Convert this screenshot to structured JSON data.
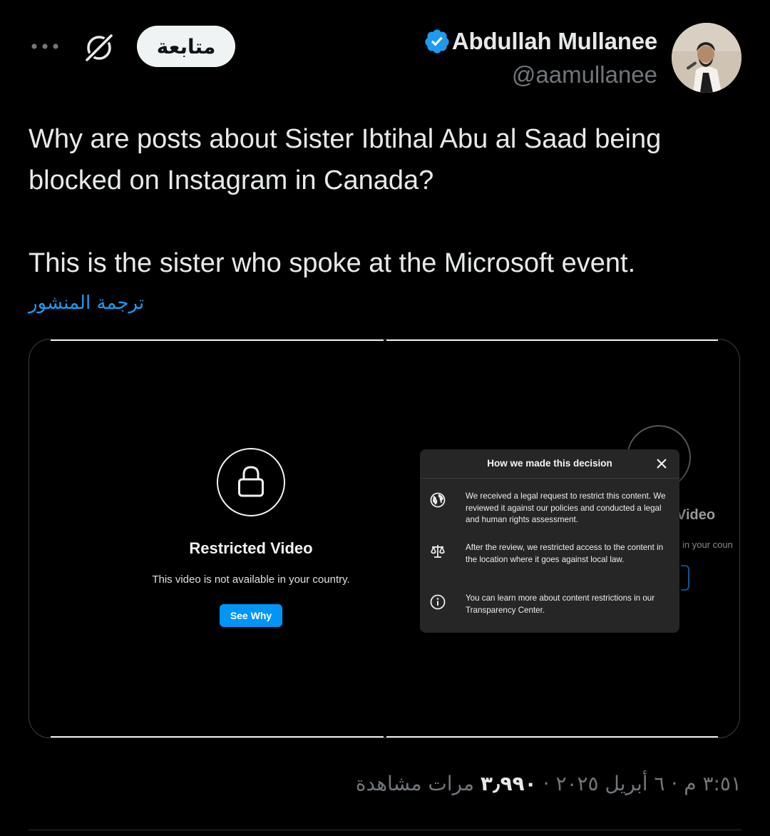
{
  "header": {
    "follow_label": "متابعة",
    "more_icon": "more-dots-icon",
    "grok_icon": "grok-icon"
  },
  "author": {
    "name": "Abdullah Mullanee",
    "handle": "@aamullanee",
    "verified": true,
    "verified_color": "#1d9bf0"
  },
  "tweet": {
    "paragraphs": [
      "Why are posts about Sister Ibtihal Abu al Saad being blocked on Instagram in Canada?",
      "This is the sister who spoke at the Microsoft event."
    ],
    "translate_label": "ترجمة المنشور"
  },
  "media": {
    "left": {
      "title": "Restricted Video",
      "message": "This video is not available in your country.",
      "button_label": "See Why",
      "button_color": "#0095f6"
    },
    "right": {
      "ghost_title": "Video",
      "ghost_subtitle": "in your coun",
      "panel": {
        "title": "How we made this decision",
        "rows": [
          {
            "icon": "globe-icon",
            "text": "We received a legal request to restrict this content. We reviewed it against our policies and conducted a legal and human rights assessment."
          },
          {
            "icon": "scales-icon",
            "text": "After the review, we restricted access to the content in the location where it goes against local law."
          },
          {
            "icon": "info-icon",
            "text": "You can learn more about content restrictions in our Transparency Center."
          }
        ]
      }
    }
  },
  "meta": {
    "time": "٣:٥١ م",
    "date": "٦ أبريل ٢٠٢٥",
    "views_count": "٣٫٩٩٠",
    "views_label": "مرات مشاهدة",
    "separator": "·"
  },
  "colors": {
    "background": "#000000",
    "text": "#e7e9ea",
    "muted": "#71767b",
    "link": "#1d9bf0"
  }
}
